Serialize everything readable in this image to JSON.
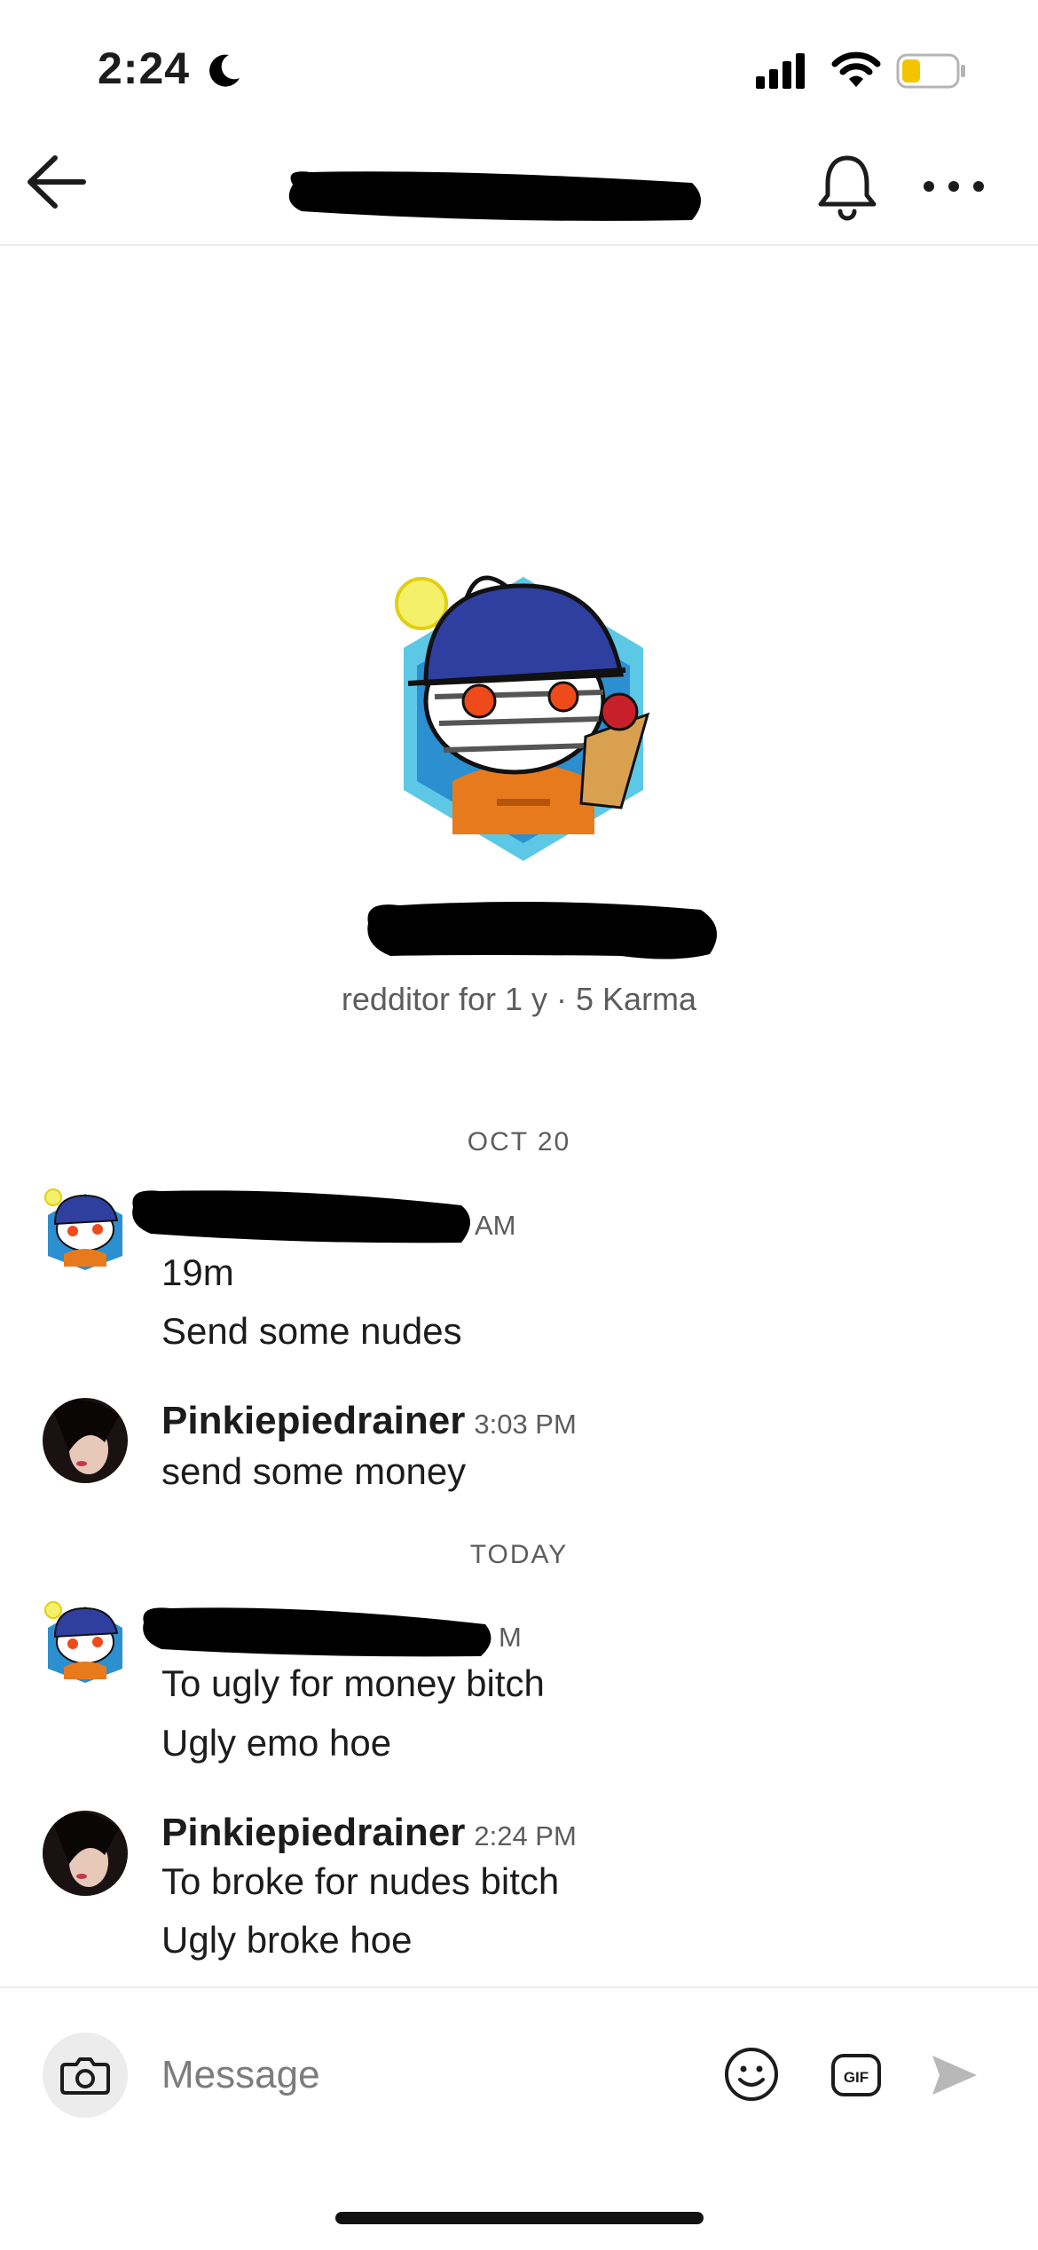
{
  "status_bar": {
    "time": "2:24",
    "battery_level": 0.35,
    "battery_color": "#f5c400"
  },
  "header": {
    "title": "",
    "back_icon": "arrow-left-icon",
    "bell_icon": "bell-icon",
    "more_icon": "more-horizontal-icon"
  },
  "profile": {
    "meta": "redditor for 1 y · 5 Karma"
  },
  "date_separators": [
    "OCT 20",
    "TODAY"
  ],
  "messages": [
    {
      "sender": "",
      "time_fragment": "AM",
      "lines": [
        "19m",
        "Send some nudes"
      ]
    },
    {
      "sender": "Pinkiepiedrainer",
      "time": "3:03 PM",
      "lines": [
        "send some money"
      ]
    },
    {
      "sender": "",
      "time_fragment": "M",
      "lines": [
        "To ugly for money bitch",
        "Ugly emo hoe"
      ]
    },
    {
      "sender": "Pinkiepiedrainer",
      "time": "2:24 PM",
      "lines": [
        "To broke for nudes bitch",
        "Ugly broke hoe"
      ]
    }
  ],
  "composer": {
    "placeholder": "Message",
    "gif_label": "GIF"
  },
  "colors": {
    "accent_blue": "#2f3fa0",
    "text_primary": "#1c1c1c",
    "text_secondary": "#5c5c5c",
    "redaction": "#000000"
  }
}
